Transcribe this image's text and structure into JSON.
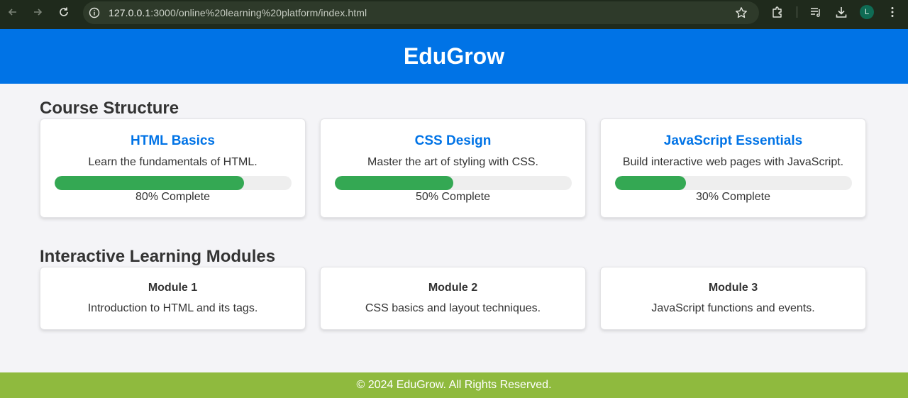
{
  "browser": {
    "url_host": "127.0.0.1",
    "url_rest": ":3000/online%20learning%20platform/index.html",
    "profile_initial": "L",
    "icons": [
      "back-icon",
      "forward-icon",
      "reload-icon",
      "site-info-icon",
      "bookmark-star-icon",
      "extensions-icon",
      "reading-list-icon",
      "download-icon",
      "menu-icon"
    ]
  },
  "header": {
    "title": "EduGrow"
  },
  "courses": {
    "title": "Course Structure",
    "items": [
      {
        "title": "HTML Basics",
        "desc": "Learn the fundamentals of HTML.",
        "progress": 80,
        "progress_text": "80% Complete"
      },
      {
        "title": "CSS Design",
        "desc": "Master the art of styling with CSS.",
        "progress": 50,
        "progress_text": "50% Complete"
      },
      {
        "title": "JavaScript Essentials",
        "desc": "Build interactive web pages with JavaScript.",
        "progress": 30,
        "progress_text": "30% Complete"
      }
    ]
  },
  "modules": {
    "title": "Interactive Learning Modules",
    "items": [
      {
        "title": "Module 1",
        "desc": "Introduction to HTML and its tags."
      },
      {
        "title": "Module 2",
        "desc": "CSS basics and layout techniques."
      },
      {
        "title": "Module 3",
        "desc": "JavaScript functions and events."
      }
    ]
  },
  "footer": {
    "text": "© 2024 EduGrow. All Rights Reserved."
  },
  "colors": {
    "primary": "#0073e6",
    "progress": "#34a853",
    "footer": "#8fba3e",
    "background": "#f4f4f7"
  }
}
